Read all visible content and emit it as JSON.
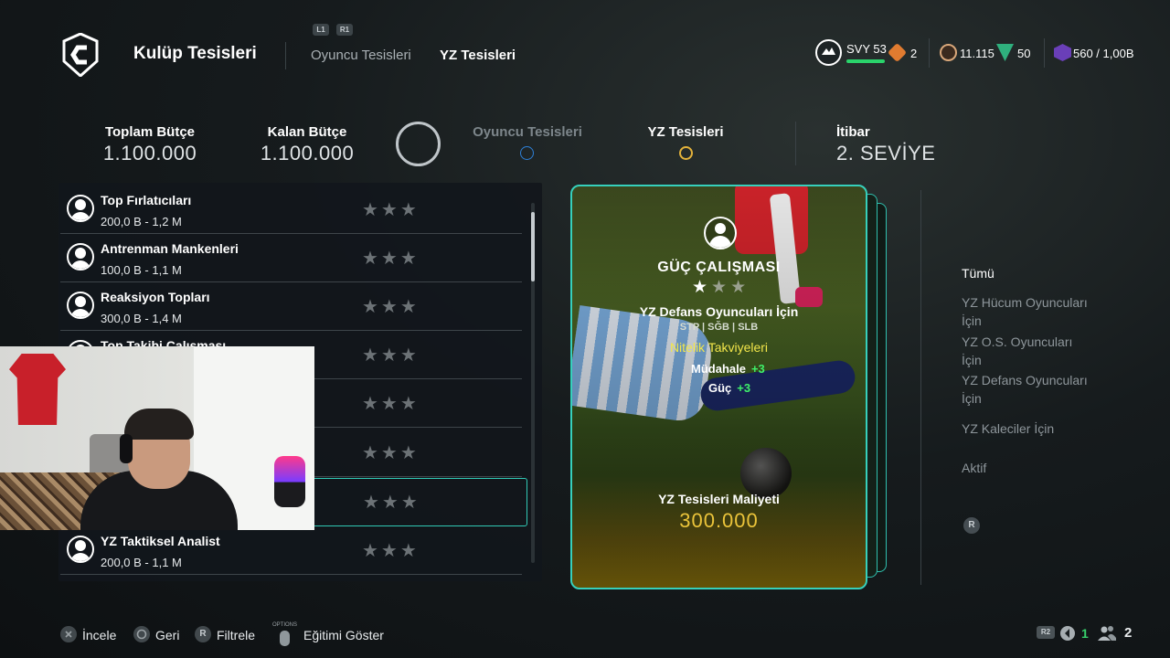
{
  "header": {
    "title": "Kulüp Tesisleri",
    "tab_badges": [
      "L1",
      "R1"
    ],
    "tabs": [
      {
        "label": "Oyuncu Tesisleri",
        "active": false
      },
      {
        "label": "YZ Tesisleri",
        "active": true
      }
    ],
    "level": {
      "label": "SVY 53"
    },
    "stats": [
      {
        "icon": "ap-icon",
        "value": "2"
      },
      {
        "icon": "coin-icon",
        "value": "11.115"
      },
      {
        "icon": "points-icon",
        "value": "50"
      },
      {
        "icon": "sp-icon",
        "value": "560 / 1,00B"
      }
    ]
  },
  "budget": {
    "total_label": "Toplam Bütçe",
    "total_value": "1.100.000",
    "remaining_label": "Kalan Bütçe",
    "remaining_value": "1.100.000",
    "player_facilities_label": "Oyuncu Tesisleri",
    "ai_facilities_label": "YZ Tesisleri",
    "reputation_label": "İtibar",
    "reputation_value": "2. SEVİYE"
  },
  "facilities": [
    {
      "name": "Top Fırlatıcıları",
      "price": "200,0 B - 1,2 M",
      "stars": "★★★"
    },
    {
      "name": "Antrenman Mankenleri",
      "price": "100,0 B - 1,1 M",
      "stars": "★★★"
    },
    {
      "name": "Reaksiyon Topları",
      "price": "300,0 B - 1,4 M",
      "stars": "★★★"
    },
    {
      "name": "Top Takibi Çalışması",
      "price": "",
      "stars": "★★★"
    },
    {
      "name": "",
      "price": "",
      "stars": "★★★"
    },
    {
      "name": "",
      "price": "",
      "stars": "★★★"
    },
    {
      "name": "",
      "price": "",
      "stars": "★★★"
    },
    {
      "name": "YZ Taktiksel Analist",
      "price": "200,0 B - 1,1 M",
      "stars": "★★★"
    }
  ],
  "card": {
    "title": "GÜÇ ÇALIŞMASI",
    "star_on": "★",
    "star_off": "★★",
    "subtitle": "YZ Defans Oyuncuları İçin",
    "positions": "STP | SĞB | SLB",
    "attributes_label": "Nitelik Takviyeleri",
    "boosts": [
      {
        "name": "Müdahale",
        "value": "+3"
      },
      {
        "name": "Güç",
        "value": "+3"
      }
    ],
    "cost_label": "YZ Tesisleri Maliyeti",
    "cost_value": "300.000"
  },
  "filters": {
    "items": [
      "Tümü",
      "YZ Hücum Oyuncuları İçin",
      "YZ O.S. Oyuncuları İçin",
      "YZ Defans Oyuncuları İçin",
      "YZ Kaleciler İçin",
      "Aktif"
    ],
    "r_label": "R"
  },
  "footer": {
    "inspect": "İncele",
    "back": "Geri",
    "filter": "Filtrele",
    "filter_key": "R",
    "options_key": "OPTIONS",
    "show_training": "Eğitimi Göster",
    "r2_key": "R2",
    "page_count": "1",
    "party_count": "2"
  },
  "colors": {
    "accent_teal": "#36d0bc",
    "level_green": "#2ad36b",
    "cost_gold": "#ebc43a",
    "boost_green": "#3ff06a",
    "attribute_yellow": "#f2e64a"
  }
}
